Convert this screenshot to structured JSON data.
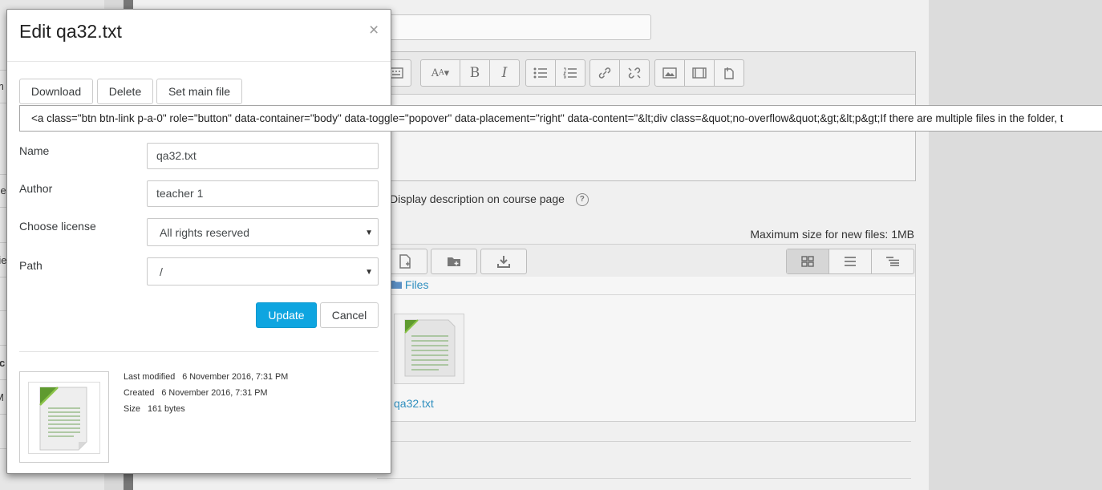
{
  "dialog": {
    "title": "Edit qa32.txt",
    "close_label": "×",
    "actions": {
      "download": "Download",
      "delete": "Delete",
      "set_main": "Set main file"
    },
    "code_text": "<a class=\"btn btn-link p-a-0\" role=\"button\" data-container=\"body\" data-toggle=\"popover\" data-placement=\"right\" data-content=\"&lt;div class=&quot;no-overflow&quot;&gt;&lt;p&gt;If there are multiple files in the folder, t",
    "fields": {
      "name_label": "Name",
      "name_value": "qa32.txt",
      "author_label": "Author",
      "author_value": "teacher 1",
      "license_label": "Choose license",
      "license_value": "All rights reserved",
      "path_label": "Path",
      "path_value": "/"
    },
    "update_label": "Update",
    "cancel_label": "Cancel",
    "info": {
      "last_modified_label": "Last modified",
      "last_modified_value": "6 November 2016, 7:31 PM",
      "created_label": "Created",
      "created_value": "6 November 2016, 7:31 PM",
      "size_label": "Size",
      "size_value": "161 bytes"
    }
  },
  "background": {
    "left_nav_fragments": [
      "l",
      "m",
      "s",
      "se",
      "-",
      "rie",
      "s",
      "s",
      "rc",
      "M",
      "s"
    ],
    "display_description_label": "Display description on course page",
    "max_size_label": "Maximum size for new files: 1MB",
    "breadcrumb_files": "Files",
    "file_name": "qa32.txt"
  },
  "colors": {
    "primary": "#0ea5e0",
    "link": "#2f8fbf",
    "overlay": "#8e8e8e"
  },
  "icons": [
    "close-icon",
    "bold-icon",
    "italic-icon",
    "bullet-list-icon",
    "numbered-list-icon",
    "link-icon",
    "unlink-icon",
    "image-icon",
    "media-icon",
    "file-icon",
    "add-file-icon",
    "create-folder-icon",
    "download-icon",
    "grid-view-icon",
    "list-view-icon",
    "tree-view-icon",
    "folder-icon",
    "text-document-icon",
    "select-arrow-icon"
  ]
}
